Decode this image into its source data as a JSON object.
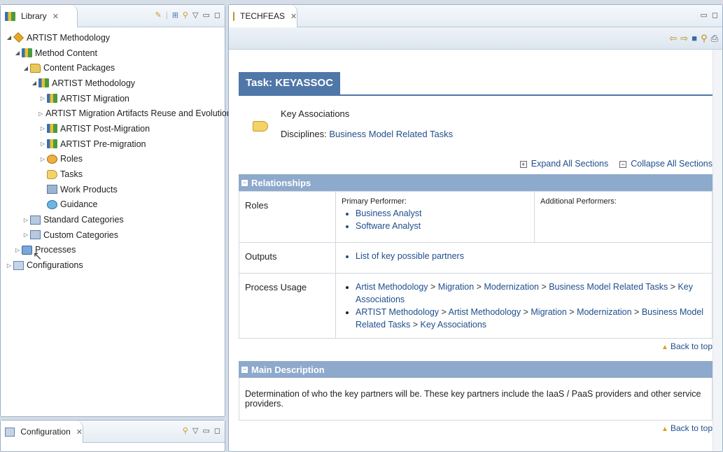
{
  "library_view": {
    "tab_label": "Library",
    "tree": [
      {
        "label": "ARTIST Methodology",
        "level": 0,
        "twisty": "open",
        "icon": "plugin-icon"
      },
      {
        "label": "Method Content",
        "level": 1,
        "twisty": "open",
        "icon": "method-content-icon"
      },
      {
        "label": "Content Packages",
        "level": 2,
        "twisty": "open",
        "icon": "folder-icon"
      },
      {
        "label": "ARTIST Methodology",
        "level": 3,
        "twisty": "open",
        "icon": "package-icon"
      },
      {
        "label": "ARTIST Migration",
        "level": 4,
        "twisty": "closed",
        "icon": "package-icon"
      },
      {
        "label": "ARTIST Migration Artifacts Reuse and Evolution",
        "level": 4,
        "twisty": "closed",
        "icon": "package-icon"
      },
      {
        "label": "ARTIST Post-Migration",
        "level": 4,
        "twisty": "closed",
        "icon": "package-icon"
      },
      {
        "label": "ARTIST Pre-migration",
        "level": 4,
        "twisty": "closed",
        "icon": "package-icon"
      },
      {
        "label": "Roles",
        "level": 4,
        "twisty": "closed",
        "icon": "roles-icon"
      },
      {
        "label": "Tasks",
        "level": 4,
        "twisty": "none",
        "icon": "tasks-icon"
      },
      {
        "label": "Work Products",
        "level": 4,
        "twisty": "none",
        "icon": "work-products-icon"
      },
      {
        "label": "Guidance",
        "level": 4,
        "twisty": "none",
        "icon": "guidance-icon"
      },
      {
        "label": "Standard Categories",
        "level": 2,
        "twisty": "closed",
        "icon": "categories-icon"
      },
      {
        "label": "Custom Categories",
        "level": 2,
        "twisty": "closed",
        "icon": "categories-icon"
      },
      {
        "label": "Processes",
        "level": 1,
        "twisty": "closed",
        "icon": "processes-icon"
      },
      {
        "label": "Configurations",
        "level": 0,
        "twisty": "closed",
        "icon": "configurations-icon"
      }
    ]
  },
  "configuration_view": {
    "tab_label": "Configuration"
  },
  "editor": {
    "tab_label": "TECHFEAS",
    "task_title": "Task: KEYASSOC",
    "presentation_name": "Key Associations",
    "disciplines_label": "Disciplines:",
    "disciplines_value": "Business Model Related Tasks",
    "expand_all": "Expand All Sections",
    "collapse_all": "Collapse All Sections",
    "relationships_header": "Relationships",
    "roles_label": "Roles",
    "primary_performer_label": "Primary Performer:",
    "primary_performers": [
      "Business Analyst",
      "Software Analyst"
    ],
    "additional_performers_label": "Additional Performers:",
    "outputs_label": "Outputs",
    "outputs": [
      "List of key possible partners"
    ],
    "process_usage_label": "Process Usage",
    "process_usage": [
      [
        "Artist Methodology",
        "Migration",
        "Modernization",
        "Business Model Related Tasks",
        "Key Associations"
      ],
      [
        "ARTIST Methodology",
        "Artist Methodology",
        "Migration",
        "Modernization",
        "Business Model Related Tasks",
        "Key Associations"
      ]
    ],
    "back_to_top": "Back to top",
    "main_description_header": "Main Description",
    "main_description": "Determination of who the key partners will be. These key partners include the IaaS / PaaS providers and other service providers."
  }
}
